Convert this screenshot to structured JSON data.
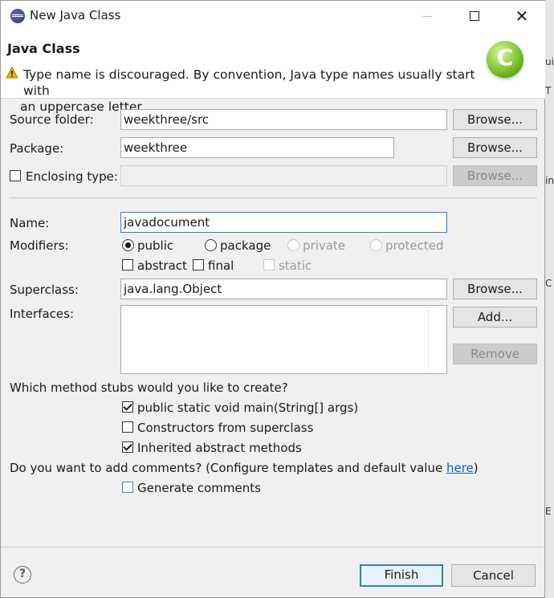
{
  "window": {
    "title": "New Java Class"
  },
  "header": {
    "title": "Java Class",
    "message_line1": "Type name is discouraged. By convention, Java type names usually start with",
    "message_line2": "an uppercase letter"
  },
  "source_folder": {
    "label": "Source folder:",
    "value": "weekthree/src",
    "browse": "Browse..."
  },
  "package": {
    "label": "Package:",
    "value": "weekthree",
    "browse": "Browse..."
  },
  "enclosing_type": {
    "label": "Enclosing type:",
    "value": "",
    "checked": false,
    "browse": "Browse..."
  },
  "name": {
    "label": "Name:",
    "value": "javadocument"
  },
  "modifiers": {
    "label": "Modifiers:",
    "public": "public",
    "package": "package",
    "private": "private",
    "protected": "protected",
    "abstract": "abstract",
    "final": "final",
    "static": "static",
    "selected": "public"
  },
  "superclass": {
    "label": "Superclass:",
    "value": "java.lang.Object",
    "browse": "Browse..."
  },
  "interfaces": {
    "label": "Interfaces:",
    "add": "Add...",
    "remove": "Remove"
  },
  "stubs": {
    "question": "Which method stubs would you like to create?",
    "main": "public static void main(String[] args)",
    "constructors": "Constructors from superclass",
    "inherited": "Inherited abstract methods",
    "main_checked": true,
    "constructors_checked": false,
    "inherited_checked": true
  },
  "comments": {
    "question": "Do you want to add comments? (Configure templates and default value ",
    "link": "here",
    "question_end": ")",
    "generate": "Generate comments",
    "generate_checked": false
  },
  "footer": {
    "help": "?",
    "finish": "Finish",
    "cancel": "Cancel"
  },
  "background_fragments": [
    "ui",
    "T",
    "in",
    "C",
    "E"
  ],
  "colors": {
    "accent": "#0b5fb3",
    "logo": "#7cc12b",
    "warning": "#f0b400"
  }
}
